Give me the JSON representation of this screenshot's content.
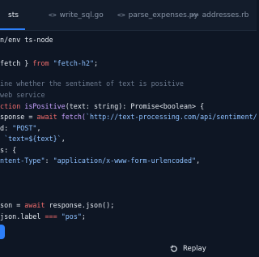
{
  "tabs": [
    {
      "label": "sts",
      "icon": "",
      "active": true
    },
    {
      "label": "write_sql.go",
      "icon": "<>",
      "active": false
    },
    {
      "label": "parse_expenses.py",
      "icon": "<>",
      "active": false
    },
    {
      "label": "addresses.rb",
      "icon": "<>",
      "active": false
    }
  ],
  "code_lines": [
    [
      {
        "t": "in/env ts-node",
        "c": "shebang"
      }
    ],
    [
      {
        "t": "",
        "c": "pl"
      }
    ],
    [
      {
        "t": " fetch } ",
        "c": "pl"
      },
      {
        "t": "from",
        "c": "kw"
      },
      {
        "t": " \"fetch-h2\"",
        "c": "str"
      },
      {
        "t": ";",
        "c": "pl"
      }
    ],
    [
      {
        "t": "",
        "c": "pl"
      }
    ],
    [
      {
        "t": "mine whether the sentiment of text is positive",
        "c": "cmt"
      }
    ],
    [
      {
        "t": " web service",
        "c": "cmt"
      }
    ],
    [
      {
        "t": "nction ",
        "c": "kw"
      },
      {
        "t": "isPositive",
        "c": "fn"
      },
      {
        "t": "(text: string): Promise<boolean> {",
        "c": "pl"
      }
    ],
    [
      {
        "t": "esponse = ",
        "c": "pl"
      },
      {
        "t": "await ",
        "c": "kw"
      },
      {
        "t": "fetch(",
        "c": "fn"
      },
      {
        "t": "`http://text-processing.com/api/sentiment/`",
        "c": "str"
      },
      {
        "t": ", {",
        "c": "pl"
      }
    ],
    [
      {
        "t": "od: ",
        "c": "pl"
      },
      {
        "t": "\"POST\"",
        "c": "str"
      },
      {
        "t": ",",
        "c": "pl"
      }
    ],
    [
      {
        "t": ": ",
        "c": "pl"
      },
      {
        "t": "`text=${text}`",
        "c": "str"
      },
      {
        "t": ",",
        "c": "pl"
      }
    ],
    [
      {
        "t": "rs: {",
        "c": "pl"
      }
    ],
    [
      {
        "t": "ontent-Type\"",
        "c": "str"
      },
      {
        "t": ": ",
        "c": "pl"
      },
      {
        "t": "\"application/x-www-form-urlencoded\"",
        "c": "str"
      },
      {
        "t": ",",
        "c": "pl"
      }
    ],
    [
      {
        "t": "",
        "c": "pl"
      }
    ],
    [
      {
        "t": "",
        "c": "pl"
      }
    ],
    [
      {
        "t": "",
        "c": "pl"
      }
    ],
    [
      {
        "t": "json = ",
        "c": "pl"
      },
      {
        "t": "await ",
        "c": "kw"
      },
      {
        "t": "response.json();",
        "c": "pl"
      }
    ],
    [
      {
        "t": " json.label ",
        "c": "pl"
      },
      {
        "t": "=== ",
        "c": "kw"
      },
      {
        "t": "\"pos\"",
        "c": "str"
      },
      {
        "t": ";",
        "c": "pl"
      }
    ]
  ],
  "replay_label": "Replay",
  "colors": {
    "background": "#0e1624",
    "accent": "#2d7ff9",
    "keyword": "#f26d6d",
    "string": "#8dc0ff",
    "function": "#c8a2ff",
    "comment": "#6d7b90"
  },
  "icons": {
    "tab_icon": "code-icon",
    "replay": "replay-icon"
  }
}
